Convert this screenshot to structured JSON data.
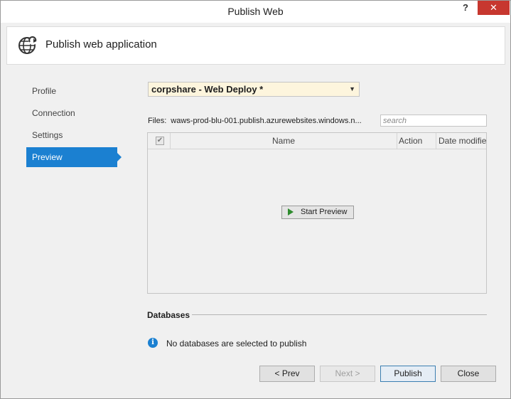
{
  "window": {
    "title": "Publish Web",
    "help_label": "?",
    "close_label": "✕"
  },
  "header": {
    "icon": "globe-publish-icon",
    "title": "Publish web application"
  },
  "sidebar": {
    "items": [
      {
        "label": "Profile",
        "active": false
      },
      {
        "label": "Connection",
        "active": false
      },
      {
        "label": "Settings",
        "active": false
      },
      {
        "label": "Preview",
        "active": true
      }
    ]
  },
  "profile_select": {
    "value": "corpshare - Web Deploy *"
  },
  "files": {
    "label": "Files:",
    "value": "waws-prod-blu-001.publish.azurewebsites.windows.n...",
    "search_placeholder": "search"
  },
  "grid": {
    "columns": [
      "Name",
      "Action",
      "Date modifie"
    ],
    "start_preview_label": "Start Preview"
  },
  "databases": {
    "label": "Databases",
    "message": "No databases are selected to publish"
  },
  "footer": {
    "prev_label": "< Prev",
    "next_label": "Next >",
    "publish_label": "Publish",
    "close_label": "Close"
  },
  "colors": {
    "accent": "#1b80d1",
    "close_button": "#c7372f",
    "selected_profile_bg": "#fdf5dd"
  }
}
